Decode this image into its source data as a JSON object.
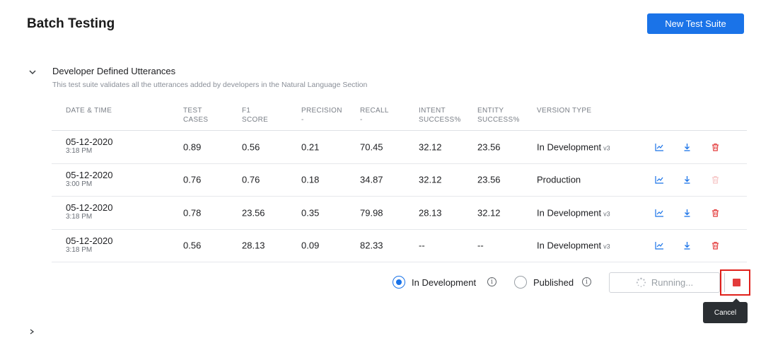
{
  "header": {
    "title": "Batch Testing",
    "new_suite_label": "New Test Suite"
  },
  "suite": {
    "title": "Developer Defined Utterances",
    "description": "This test suite validates all the utterances added by developers in the Natural Language Section"
  },
  "table": {
    "headers": {
      "date": "DATE & TIME",
      "test1": "TEST",
      "test2": "CASES",
      "f1a": "F1",
      "f1b": "SCORE",
      "prec1": "PRECISION",
      "prec2": "-",
      "rec1": "RECALL",
      "rec2": "-",
      "int1": "INTENT",
      "int2": "SUCCESS%",
      "ent1": "ENTITY",
      "ent2": "SUCCESS%",
      "ver": "VERSION TYPE"
    },
    "rows": [
      {
        "date": "05-12-2020",
        "time": "3:18 PM",
        "test_cases": "0.89",
        "f1": "0.56",
        "precision": "0.21",
        "recall": "70.45",
        "intent": "32.12",
        "entity": "23.56",
        "version": "In Development",
        "version_sub": "v3",
        "delete_enabled": true
      },
      {
        "date": "05-12-2020",
        "time": "3:00 PM",
        "test_cases": "0.76",
        "f1": "0.76",
        "precision": "0.18",
        "recall": "34.87",
        "intent": "32.12",
        "entity": "23.56",
        "version": "Production",
        "version_sub": "",
        "delete_enabled": false
      },
      {
        "date": "05-12-2020",
        "time": "3:18 PM",
        "test_cases": "0.78",
        "f1": "23.56",
        "precision": "0.35",
        "recall": "79.98",
        "intent": "28.13",
        "entity": "32.12",
        "version": "In Development",
        "version_sub": "v3",
        "delete_enabled": true
      },
      {
        "date": "05-12-2020",
        "time": "3:18 PM",
        "test_cases": "0.56",
        "f1": "28.13",
        "precision": "0.09",
        "recall": "82.33",
        "intent": "--",
        "entity": "--",
        "version": "In Development",
        "version_sub": "v3",
        "delete_enabled": true
      }
    ]
  },
  "footer": {
    "radio_dev_label": "In Development",
    "radio_pub_label": "Published",
    "selected": "In Development",
    "running_label": "Running...",
    "tooltip": "Cancel"
  },
  "icons": {
    "chart": "line-chart-icon",
    "download": "download-icon",
    "delete": "trash-icon",
    "info": "info-icon",
    "spinner": "spinner-icon",
    "stop": "stop-icon"
  },
  "colors": {
    "primary": "#1a73e8",
    "danger": "#e33b3b",
    "highlight_border": "#e0201b",
    "tooltip_bg": "#2b2f33"
  }
}
